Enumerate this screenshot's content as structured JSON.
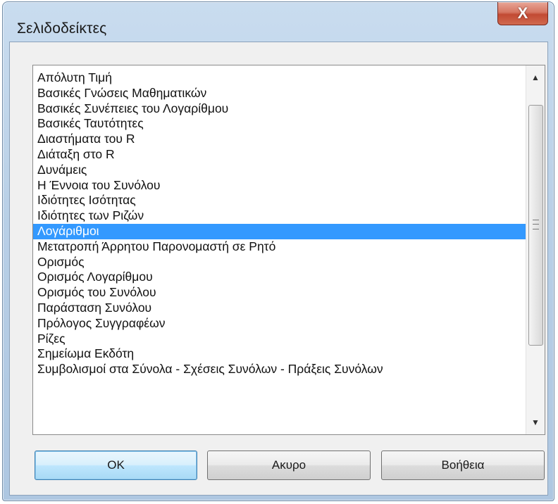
{
  "window": {
    "title": "Σελιδοδείκτες",
    "close_label": "X"
  },
  "bookmarks": {
    "selected_index": 10,
    "items": [
      "Απόλυτη Τιμή",
      "Βασικές Γνώσεις Μαθηματικών",
      "Βασικές Συνέπειες του Λογαρίθμου",
      "Βασικές Ταυτότητες",
      "Διαστήματα του R",
      "Διάταξη στο R",
      "Δυνάμεις",
      "Η Έννοια του Συνόλου",
      "Ιδιότητες Ισότητας",
      "Ιδιότητες των Ριζών",
      "Λογάριθμοι",
      "Μετατροπή Άρρητου Παρονομαστή σε Ρητό",
      "Ορισμός",
      "Ορισμός Λογαρίθμου",
      "Ορισμός του Συνόλου",
      "Παράσταση Συνόλου",
      "Πρόλογος Συγγραφέων",
      "Ρίζες",
      "Σημείωμα Εκδότη",
      "Συμβολισμοί στα Σύνολα - Σχέσεις Συνόλων - Πράξεις Συνόλων"
    ]
  },
  "buttons": {
    "ok": "OK",
    "cancel": "Ακυρο",
    "help": "Βοήθεια"
  },
  "colors": {
    "selection": "#3399ff",
    "close_button": "#c24a33",
    "window_frame": "#b8cfe6"
  }
}
